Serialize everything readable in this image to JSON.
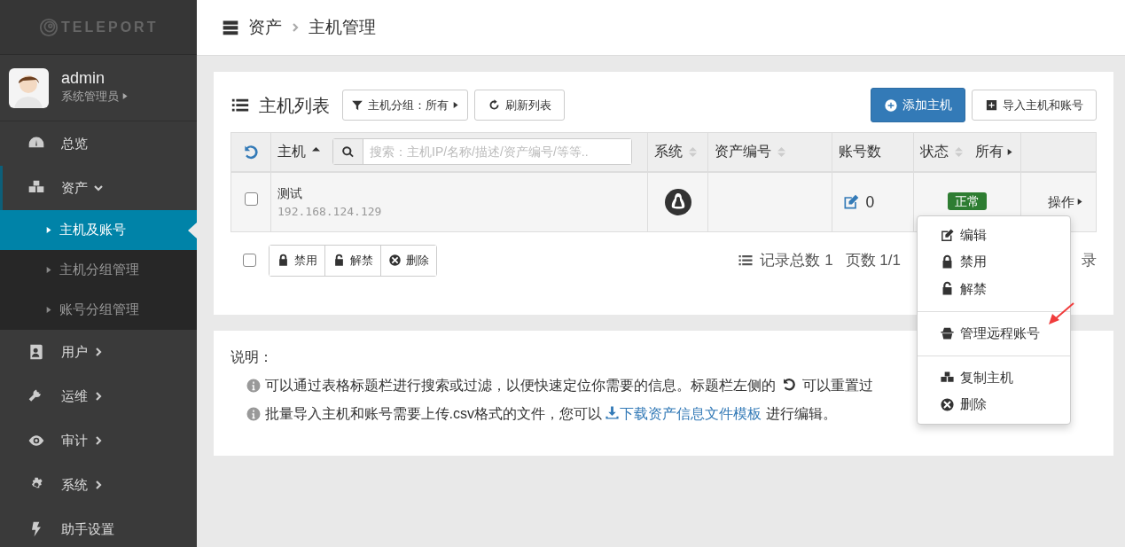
{
  "logo": {
    "text": "TELEPORT"
  },
  "user": {
    "name": "admin",
    "role": "系统管理员"
  },
  "sidebar": {
    "items": [
      {
        "label": "总览",
        "selected": false
      },
      {
        "label": "资产",
        "selected": true,
        "expanded": true,
        "children": [
          {
            "label": "主机及账号",
            "selected": true
          },
          {
            "label": "主机分组管理",
            "selected": false
          },
          {
            "label": "账号分组管理",
            "selected": false
          }
        ]
      },
      {
        "label": "用户",
        "selected": false,
        "expanded": false
      },
      {
        "label": "运维",
        "selected": false,
        "expanded": false
      },
      {
        "label": "审计",
        "selected": false,
        "expanded": false
      },
      {
        "label": "系统",
        "selected": false,
        "expanded": false
      },
      {
        "label": "助手设置",
        "selected": false
      }
    ]
  },
  "breadcrumb": [
    "资产",
    "主机管理"
  ],
  "host_list": {
    "title": "主机列表",
    "group_filter": {
      "label": "主机分组：",
      "value": "所有"
    },
    "refresh_button": "刷新列表",
    "add_button": "添加主机",
    "import_button": "导入主机和账号",
    "search": {
      "placeholder": "搜索：主机IP/名称/描述/资产编号/等等.."
    },
    "columns": [
      {
        "label": "主机",
        "sorted": true
      },
      {
        "label": "系统",
        "sorted": false
      },
      {
        "label": "资产编号",
        "sorted": false
      },
      {
        "label": "账号数"
      },
      {
        "label": "状态",
        "sorted": false,
        "filter": "所有"
      }
    ],
    "rows": [
      {
        "checked": false,
        "name": "测试",
        "ip": "192.168.124.129",
        "account_count": "0",
        "status": "正常",
        "enabled": true,
        "action": "操作"
      }
    ],
    "bulk": {
      "checked": false,
      "buttons": [
        "禁用",
        "解禁",
        "删除"
      ]
    },
    "pager": {
      "total": "记录总数 1",
      "pages": "页数 1/1",
      "tail": "录"
    }
  },
  "action_menu": {
    "groups": [
      [
        "编辑",
        "禁用",
        "解禁"
      ],
      [
        "管理远程账号"
      ],
      [
        "复制主机",
        "删除"
      ]
    ]
  },
  "notes": {
    "title": "说明：",
    "items": [
      {
        "before": "可以通过表格标题栏进行搜索或过滤，以便快速定位你需要的信息。标题栏左侧的",
        "after": "可以重置过"
      },
      {
        "before": "批量导入主机和账号需要上传.csv格式的文件，您可以",
        "link": "下载资产信息文件模板",
        "after": "进行编辑。"
      }
    ]
  }
}
